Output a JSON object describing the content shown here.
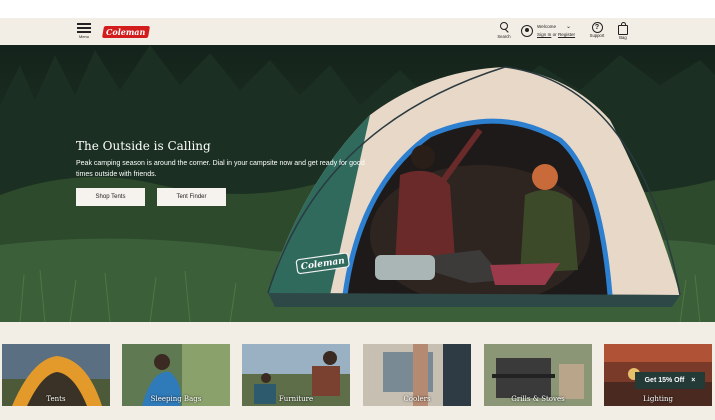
{
  "header": {
    "menu_label": "Menu",
    "logo_text": "Coleman",
    "search_label": "Search",
    "welcome": "Welcome",
    "sign_in": "Sign In",
    "or": "or",
    "register": "Register",
    "support_label": "Support",
    "bag_label": "Bag"
  },
  "hero": {
    "title": "The Outside is Calling",
    "subtitle": "Peak camping season is around the corner. Dial in your campsite now and get ready for good times outside with friends.",
    "buttons": [
      "Shop Tents",
      "Tent Finder"
    ],
    "tent_logo": "Coleman"
  },
  "categories": [
    "Tents",
    "Sleeping Bags",
    "Furniture",
    "Coolers",
    "Grills & Stoves",
    "Lighting"
  ],
  "promo": {
    "label": "Get 15% Off",
    "close": "×"
  },
  "colors": {
    "brand_red": "#d31c1c",
    "header_bg": "#f2ede5",
    "promo_bg": "#243a36",
    "tent_blue": "#2d7fd0"
  }
}
